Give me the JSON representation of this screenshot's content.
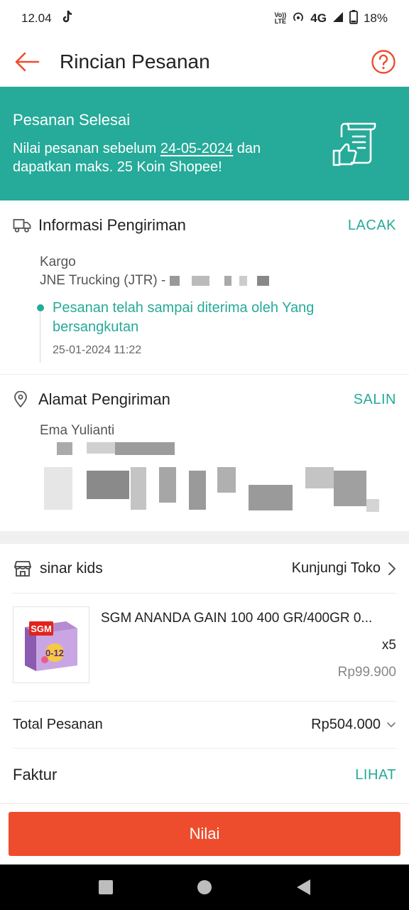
{
  "status_bar": {
    "time": "12.04",
    "network": "4G",
    "battery": "18%",
    "volte_top": "Vo))",
    "volte_bottom": "LTE"
  },
  "header": {
    "title": "Rincian Pesanan"
  },
  "banner": {
    "title": "Pesanan Selesai",
    "desc_prefix": "Nilai pesanan sebelum ",
    "deadline": "24-05-2024",
    "desc_suffix": " dan dapatkan maks. 25 Koin Shopee!",
    "color": "#26aa99"
  },
  "shipping": {
    "title": "Informasi Pengiriman",
    "action": "LACAK",
    "service": "Kargo",
    "courier": "JNE Trucking (JTR) -",
    "event": "Pesanan telah sampai diterima oleh Yang bersangkutan",
    "timestamp": "25-01-2024 11:22"
  },
  "address": {
    "title": "Alamat Pengiriman",
    "action": "SALIN",
    "name": "Ema Yulianti"
  },
  "shop": {
    "name": "sinar kids",
    "visit": "Kunjungi Toko",
    "product": {
      "name": "SGM ANANDA GAIN 100 400 GR/400GR 0...",
      "qty": "x5",
      "price": "Rp99.900",
      "thumb_brand": "SGM",
      "thumb_age": "0-12"
    },
    "total_label": "Total Pesanan",
    "total_value": "Rp504.000",
    "invoice_label": "Faktur",
    "invoice_action": "LIHAT"
  },
  "cta": {
    "label": "Nilai",
    "color": "#ee4d2d"
  }
}
